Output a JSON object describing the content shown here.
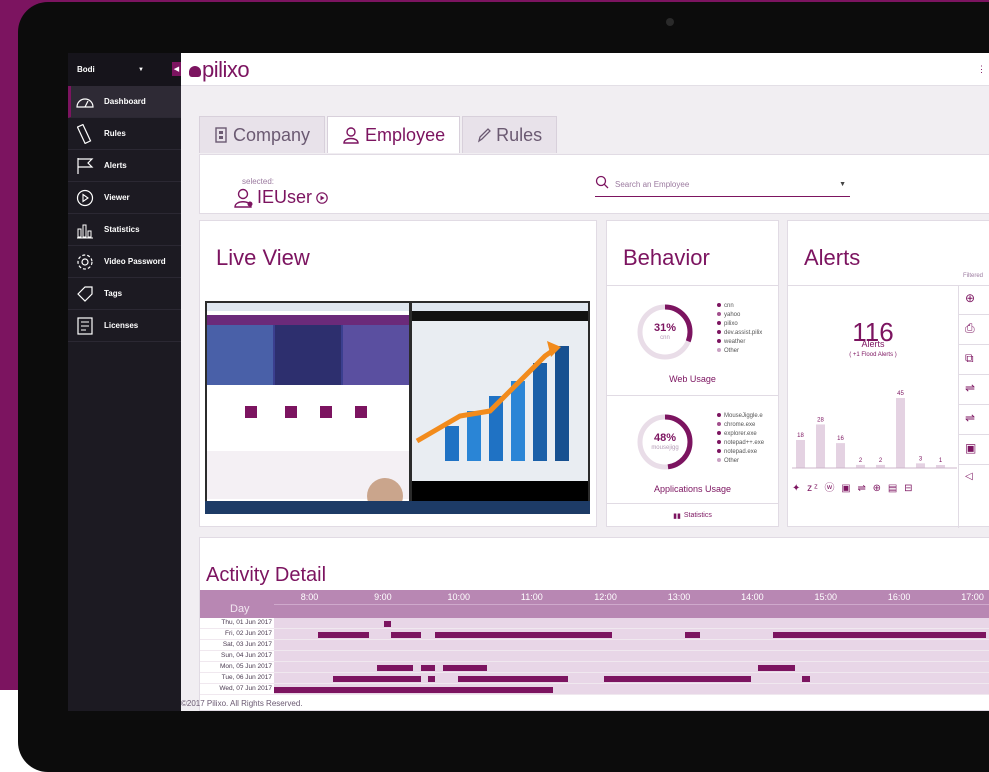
{
  "sidebar": {
    "account": "Bodi",
    "items": [
      {
        "label": "Dashboard",
        "icon": "dashboard-gauge-icon",
        "active": true
      },
      {
        "label": "Rules",
        "icon": "ruler-icon"
      },
      {
        "label": "Alerts",
        "icon": "flag-icon"
      },
      {
        "label": "Viewer",
        "icon": "play-icon"
      },
      {
        "label": "Statistics",
        "icon": "bar-chart-icon"
      },
      {
        "label": "Video Password",
        "icon": "gear-icon"
      },
      {
        "label": "Tags",
        "icon": "tag-icon"
      },
      {
        "label": "Licenses",
        "icon": "license-icon"
      }
    ]
  },
  "brand": {
    "logo": "pilixo",
    "accent": "#7c1460"
  },
  "tabs": [
    {
      "label": "Company",
      "icon": "building-icon"
    },
    {
      "label": "Employee",
      "icon": "user-icon",
      "active": true
    },
    {
      "label": "Rules",
      "icon": "pencil-icon"
    }
  ],
  "user": {
    "selected_label": "selected:",
    "name": "IEUser"
  },
  "search": {
    "placeholder": "Search an Employee"
  },
  "live": {
    "title": "Live View"
  },
  "behavior": {
    "title": "Behavior",
    "web": {
      "percent": 31,
      "percent_text": "31%",
      "top": "cnn",
      "label": "Web Usage",
      "legend": [
        "cnn",
        "yahoo",
        "pilixo",
        "dev.assist.pilix",
        "weather",
        "Other"
      ]
    },
    "apps": {
      "percent": 48,
      "percent_text": "48%",
      "top": "mousejigg",
      "label": "Applications Usage",
      "legend": [
        "MouseJiggle.e",
        "chrome.exe",
        "explorer.exe",
        "notepad++.exe",
        "notepad.exe",
        "Other"
      ]
    },
    "statistics_link": "Statistics"
  },
  "alerts": {
    "title": "Alerts",
    "filtered_label": "Filtered",
    "count": "116",
    "count_label": "Alerts",
    "flood_label": "( +1 Flood Alerts )",
    "bars": [
      18,
      28,
      16,
      2,
      2,
      45,
      3,
      1
    ]
  },
  "activity": {
    "title": "Activity Detail",
    "day_label": "Day",
    "hours": [
      "8:00",
      "9:00",
      "10:00",
      "11:00",
      "12:00",
      "13:00",
      "14:00",
      "15:00",
      "16:00",
      "17:00"
    ],
    "days": [
      "Thu, 01 Jun 2017",
      "Fri, 02 Jun 2017",
      "Sat, 03 Jun 2017",
      "Sun, 04 Jun 2017",
      "Mon, 05 Jun 2017",
      "Tue, 06 Jun 2017",
      "Wed, 07 Jun 2017"
    ]
  },
  "footer": "©2017 Pilixo. All Rights Reserved."
}
